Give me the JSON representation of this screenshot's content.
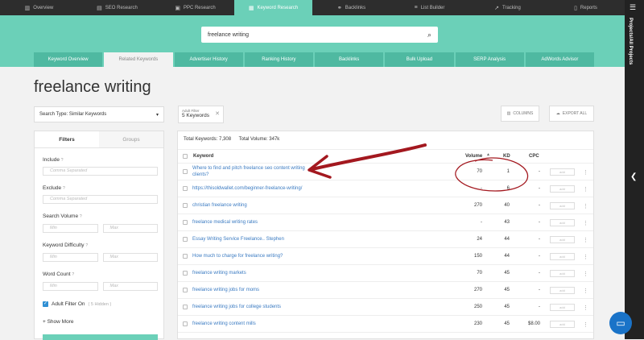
{
  "topnav": {
    "tabs": [
      {
        "label": "Overview",
        "icon": "chart-icon"
      },
      {
        "label": "SEO Research",
        "icon": "seo-icon"
      },
      {
        "label": "PPC Research",
        "icon": "ppc-icon"
      },
      {
        "label": "Keyword Research",
        "icon": "key-icon",
        "active": true
      },
      {
        "label": "Backlinks",
        "icon": "link-icon"
      },
      {
        "label": "List Builder",
        "icon": "list-icon"
      },
      {
        "label": "Tracking",
        "icon": "tracking-icon"
      },
      {
        "label": "Reports",
        "icon": "report-icon"
      }
    ]
  },
  "search": {
    "value": "freelance writing",
    "icon": "search-icon"
  },
  "subtabs": [
    "Keyword Overview",
    "Related Keywords",
    "Advertiser History",
    "Ranking History",
    "Backlinks",
    "Bulk Upload",
    "SERP Analysis",
    "AdWords Advisor"
  ],
  "side": {
    "label": "Projects/All Projects"
  },
  "page_title": "freelance writing",
  "search_type": {
    "label": "Search Type: Similar Keywords"
  },
  "filter_chip": {
    "line1": "Adult Filter",
    "line2": "5 Keywords"
  },
  "buttons": {
    "columns": "COLUMNS",
    "export": "EXPORT ALL"
  },
  "filters": {
    "tabs": [
      "Filters",
      "Groups"
    ],
    "include": {
      "label": "Include",
      "placeholder": "Comma Separated"
    },
    "exclude": {
      "label": "Exclude",
      "placeholder": "Comma Separated"
    },
    "search_volume": {
      "label": "Search Volume",
      "min": "Min",
      "max": "Max"
    },
    "keyword_difficulty": {
      "label": "Keyword Difficulty",
      "min": "Min",
      "max": "Max"
    },
    "word_count": {
      "label": "Word Count",
      "min": "Min",
      "max": "Max"
    },
    "adult_filter": {
      "label": "Adult Filter On",
      "hidden": "( 5 Hidden )"
    },
    "show_more": "+ Show More"
  },
  "results": {
    "total_keywords": "Total Keywords: 7,308",
    "total_volume": "Total Volume: 347k",
    "headers": {
      "keyword": "Keyword",
      "volume": "Volume",
      "kd": "KD",
      "cpc": "CPC"
    },
    "add_label": "add",
    "rows": [
      {
        "keyword": "Where to find and pitch freelance seo content writing clients?",
        "volume": "70",
        "kd": "1",
        "cpc": "-"
      },
      {
        "keyword": "https://thisoldwallet.com/beginner-freelance-writing/",
        "volume": "-",
        "kd": "6",
        "cpc": "-"
      },
      {
        "keyword": "christian freelance writing",
        "volume": "270",
        "kd": "40",
        "cpc": "-"
      },
      {
        "keyword": "freelance medical writing rates",
        "volume": "-",
        "kd": "43",
        "cpc": "-"
      },
      {
        "keyword": "Essay Writing Service Freelance.. Stephen",
        "volume": "24",
        "kd": "44",
        "cpc": "-"
      },
      {
        "keyword": "How much to charge for freelance writing?",
        "volume": "150",
        "kd": "44",
        "cpc": "-"
      },
      {
        "keyword": "freelance writing markets",
        "volume": "70",
        "kd": "45",
        "cpc": "-"
      },
      {
        "keyword": "freelance writing jobs for moms",
        "volume": "270",
        "kd": "45",
        "cpc": "-"
      },
      {
        "keyword": "freelance writing jobs for college students",
        "volume": "250",
        "kd": "45",
        "cpc": "-"
      },
      {
        "keyword": "freelance writing content mills",
        "volume": "230",
        "kd": "45",
        "cpc": "$8.00"
      }
    ]
  },
  "colors": {
    "teal": "#6bd0b8",
    "dark": "#2d2d2d",
    "link": "#3b7bc2",
    "annotation": "#a3181f"
  }
}
